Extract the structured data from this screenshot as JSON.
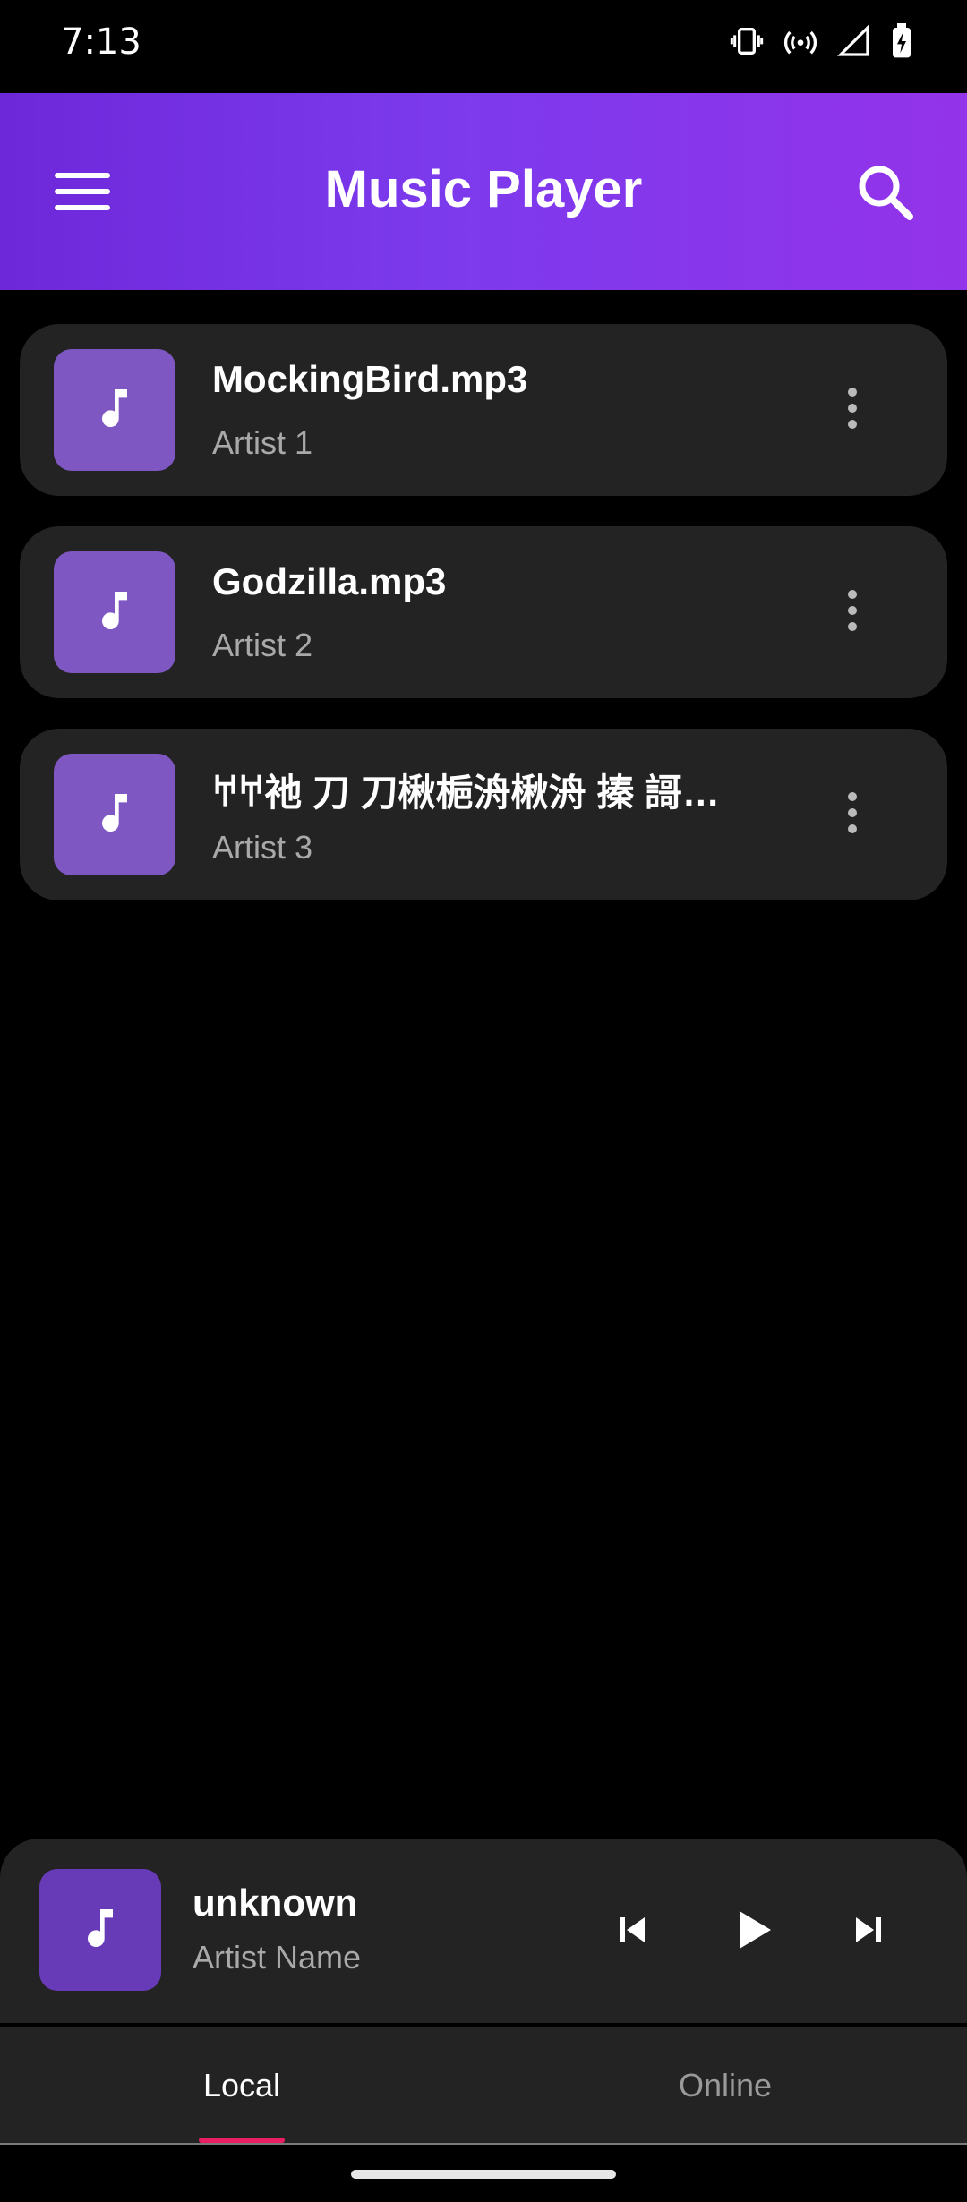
{
  "status_bar": {
    "time": "7:13",
    "icons": [
      "vibrate-icon",
      "hotspot-icon",
      "signal-icon",
      "battery-charging-icon"
    ]
  },
  "app_bar": {
    "title": "Music Player",
    "menu_icon": "menu-icon",
    "search_icon": "search-icon",
    "gradient": [
      "#6d28d9",
      "#9333ea"
    ]
  },
  "songs": [
    {
      "title": "MockingBird.mp3",
      "artist": "Artist 1"
    },
    {
      "title": "Godzilla.mp3",
      "artist": "Artist 2"
    },
    {
      "title": "𐀀𐀀祂 刀 刀楸梔洀楸洀 搸 謌…",
      "artist": "Artist 3"
    }
  ],
  "now_playing": {
    "title": "unknown",
    "artist": "Artist Name",
    "controls": [
      "skip-previous-icon",
      "play-icon",
      "skip-next-icon"
    ]
  },
  "bottom_nav": {
    "tabs": [
      {
        "label": "Local",
        "active": true
      },
      {
        "label": "Online",
        "active": false
      }
    ],
    "indicator_color": "#e91e63"
  },
  "colors": {
    "card_bg": "#232323",
    "art_bg": "#7e57c2",
    "mini_art_bg": "#673ab7"
  }
}
